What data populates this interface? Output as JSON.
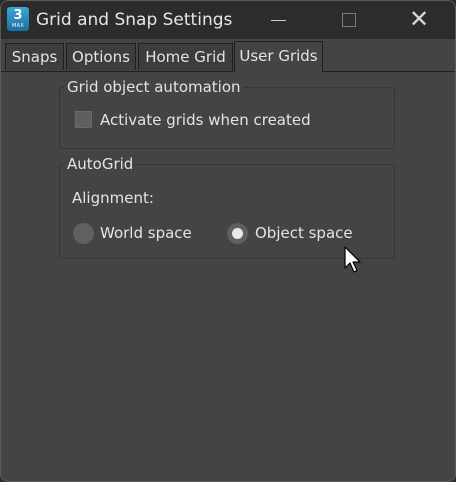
{
  "window": {
    "title": "Grid and Snap Settings",
    "app_icon": {
      "number": "3",
      "sub": "MAX",
      "icon": "3ds-max-app-icon"
    },
    "controls": {
      "minimize_icon": "minimize-icon",
      "maximize_icon": "maximize-icon",
      "close_icon": "close-icon",
      "close_glyph": "✕"
    }
  },
  "tabs": [
    {
      "label": "Snaps",
      "active": false
    },
    {
      "label": "Options",
      "active": false
    },
    {
      "label": "Home Grid",
      "active": false
    },
    {
      "label": "User Grids",
      "active": true
    }
  ],
  "grid_object_automation": {
    "title": "Grid object automation",
    "activate_checkbox": {
      "label": "Activate grids when created",
      "checked": false
    }
  },
  "autogrid": {
    "title": "AutoGrid",
    "alignment_label": "Alignment:",
    "options": [
      {
        "label": "World space",
        "selected": false
      },
      {
        "label": "Object space",
        "selected": true
      }
    ]
  },
  "colors": {
    "window_bg": "#444444",
    "titlebar_bg": "#2c2c2c",
    "text": "#e4e4e4",
    "app_icon_accent": "#2b8cc4"
  }
}
